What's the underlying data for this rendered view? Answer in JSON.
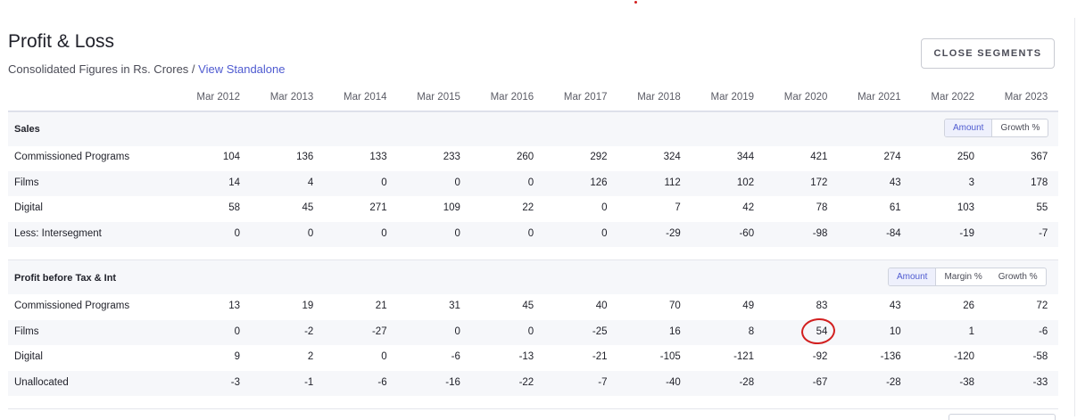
{
  "header": {
    "title": "Profit & Loss",
    "subtitle_text": "Consolidated Figures in Rs. Crores / ",
    "standalone_link": "View Standalone",
    "close_segments_label": "CLOSE SEGMENTS"
  },
  "years": [
    "Mar 2012",
    "Mar 2013",
    "Mar 2014",
    "Mar 2015",
    "Mar 2016",
    "Mar 2017",
    "Mar 2018",
    "Mar 2019",
    "Mar 2020",
    "Mar 2021",
    "Mar 2022",
    "Mar 2023"
  ],
  "sales": {
    "title": "Sales",
    "toggles": [
      "Amount",
      "Growth %"
    ],
    "active_toggle": "Amount",
    "rows": [
      {
        "label": "Commissioned Programs",
        "values": [
          "104",
          "136",
          "133",
          "233",
          "260",
          "292",
          "324",
          "344",
          "421",
          "274",
          "250",
          "367"
        ]
      },
      {
        "label": "Films",
        "values": [
          "14",
          "4",
          "0",
          "0",
          "0",
          "126",
          "112",
          "102",
          "172",
          "43",
          "3",
          "178"
        ]
      },
      {
        "label": "Digital",
        "values": [
          "58",
          "45",
          "271",
          "109",
          "22",
          "0",
          "7",
          "42",
          "78",
          "61",
          "103",
          "55"
        ]
      },
      {
        "label": "Less: Intersegment",
        "values": [
          "0",
          "0",
          "0",
          "0",
          "0",
          "0",
          "-29",
          "-60",
          "-98",
          "-84",
          "-19",
          "-7"
        ]
      }
    ]
  },
  "pbt": {
    "title": "Profit before Tax & Int",
    "toggles": [
      "Amount",
      "Margin %",
      "Growth %"
    ],
    "active_toggle": "Amount",
    "rows": [
      {
        "label": "Commissioned Programs",
        "values": [
          "13",
          "19",
          "21",
          "31",
          "45",
          "40",
          "70",
          "49",
          "83",
          "43",
          "26",
          "72"
        ]
      },
      {
        "label": "Films",
        "values": [
          "0",
          "-2",
          "-27",
          "0",
          "0",
          "-25",
          "16",
          "8",
          "54",
          "10",
          "1",
          "-6"
        ]
      },
      {
        "label": "Digital",
        "values": [
          "9",
          "2",
          "0",
          "-6",
          "-13",
          "-21",
          "-105",
          "-121",
          "-92",
          "-136",
          "-120",
          "-58"
        ]
      },
      {
        "label": "Unallocated",
        "values": [
          "-3",
          "-1",
          "-6",
          "-16",
          "-22",
          "-7",
          "-40",
          "-28",
          "-67",
          "-28",
          "-38",
          "-33"
        ]
      }
    ]
  },
  "colors": {
    "accent": "#4e5ad0",
    "annotation": "#d21f1f",
    "row_alt": "#f6f7fa"
  }
}
